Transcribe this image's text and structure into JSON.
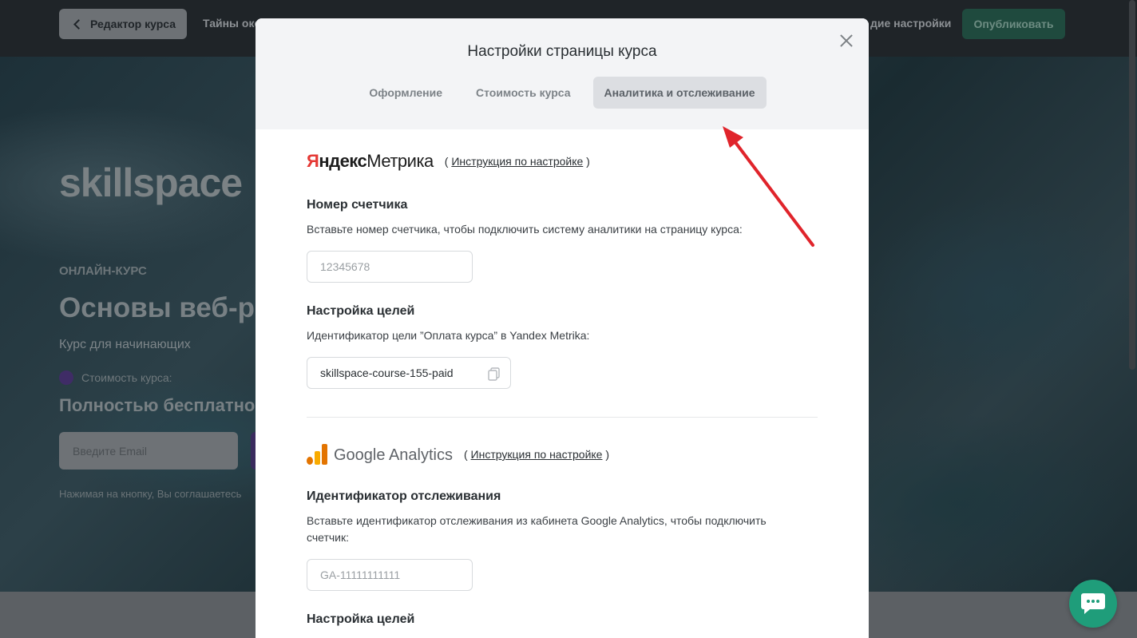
{
  "topbar": {
    "back_label": "Редактор курса",
    "course_crumb": "Тайны оке",
    "general_settings": "дие настройки",
    "publish_label": "Опубликовать"
  },
  "hero": {
    "logo": "skillspace",
    "kicker": "ОНЛАЙН-КУРС",
    "title": "Основы веб-ра",
    "subtitle": "Курс для начинающих",
    "price_label": "Стоимость курса:",
    "price_value": "Полностью бесплатно",
    "email_placeholder": "Введите Email",
    "agree_text": "Нажимая на кнопку, Вы соглашаетесь"
  },
  "modal": {
    "title": "Настройки страницы курса",
    "tabs": [
      {
        "label": "Оформление",
        "active": false
      },
      {
        "label": "Стоимость курса",
        "active": false
      },
      {
        "label": "Аналитика и отслеживание",
        "active": true
      }
    ],
    "yandex": {
      "logo_ya": "Я",
      "logo_ndeks": "ндекс",
      "logo_metrika": "Метрика",
      "instr_open": "(",
      "instr_link": "Инструкция по настройке",
      "instr_close": ")",
      "counter_title": "Номер счетчика",
      "counter_desc": "Вставьте номер счетчика, чтобы подключить систему аналитики на страницу курса:",
      "counter_placeholder": "12345678",
      "goals_title": "Настройка целей",
      "goals_desc": "Идентификатор цели ”Оплата курса” в Yandex Metrika:",
      "goal_id": "skillspace-course-155-paid"
    },
    "google": {
      "logo_text": "Google Analytics",
      "instr_open": "(",
      "instr_link": "Инструкция по настройке",
      "instr_close": ")",
      "tracking_title": "Идентификатор отслеживания",
      "tracking_desc": "Вставьте идентификатор отслеживания из кабинета Google Analytics, чтобы подключить счетчик:",
      "tracking_placeholder": "GA-11111111111",
      "goals_title": "Настройка целей"
    }
  },
  "colors": {
    "accent_green": "#1f9d7a",
    "annotation_red": "#e0242b",
    "yandex_red": "#e53935",
    "ga_orange": "#f9ab00",
    "ga_dark_orange": "#e37400"
  }
}
